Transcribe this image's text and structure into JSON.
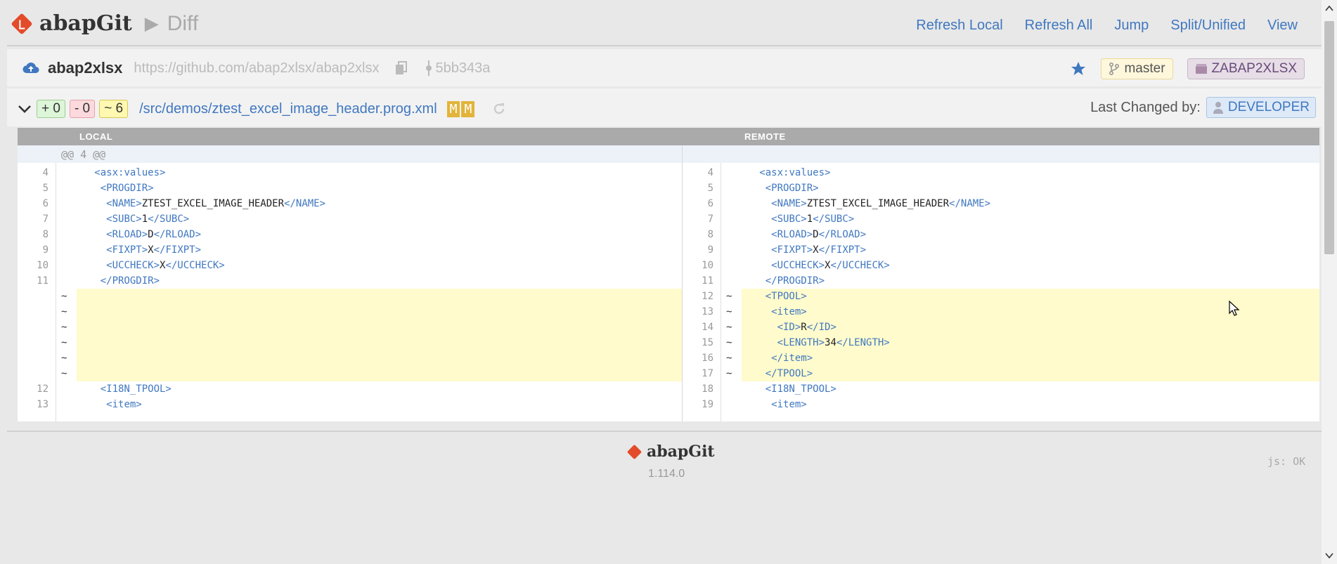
{
  "header": {
    "brand": "abapGit",
    "separator": "▶",
    "page": "Diff",
    "nav": [
      "Refresh Local",
      "Refresh All",
      "Jump",
      "Split/Unified",
      "View"
    ]
  },
  "repo": {
    "name": "abap2xlsx",
    "url": "https://github.com/abap2xlsx/abap2xlsx",
    "commit": "5bb343a",
    "branch": "master",
    "package": "ZABAP2XLSX"
  },
  "file": {
    "stat_add": "+ 0",
    "stat_del": "- 0",
    "stat_mod": "~ 6",
    "path": "/src/demos/ztest_excel_image_header.prog.xml",
    "local_state": "M",
    "remote_state": "M",
    "last_changed_label": "Last Changed by:",
    "last_changed_user": "DEVELOPER"
  },
  "diff": {
    "local_label": "LOCAL",
    "remote_label": "REMOTE",
    "hunk": "@@ 4 @@",
    "rows": [
      {
        "ln": "4",
        "lt": "   <asx:values>",
        "rn": "4",
        "rt": "   <asx:values>",
        "changed": false
      },
      {
        "ln": "5",
        "lt": "    <PROGDIR>",
        "rn": "5",
        "rt": "    <PROGDIR>",
        "changed": false
      },
      {
        "ln": "6",
        "lt": "     <NAME>ZTEST_EXCEL_IMAGE_HEADER</NAME>",
        "rn": "6",
        "rt": "     <NAME>ZTEST_EXCEL_IMAGE_HEADER</NAME>",
        "changed": false
      },
      {
        "ln": "7",
        "lt": "     <SUBC>1</SUBC>",
        "rn": "7",
        "rt": "     <SUBC>1</SUBC>",
        "changed": false
      },
      {
        "ln": "8",
        "lt": "     <RLOAD>D</RLOAD>",
        "rn": "8",
        "rt": "     <RLOAD>D</RLOAD>",
        "changed": false
      },
      {
        "ln": "9",
        "lt": "     <FIXPT>X</FIXPT>",
        "rn": "9",
        "rt": "     <FIXPT>X</FIXPT>",
        "changed": false
      },
      {
        "ln": "10",
        "lt": "     <UCCHECK>X</UCCHECK>",
        "rn": "10",
        "rt": "     <UCCHECK>X</UCCHECK>",
        "changed": false
      },
      {
        "ln": "11",
        "lt": "    </PROGDIR>",
        "rn": "11",
        "rt": "    </PROGDIR>",
        "changed": false
      },
      {
        "ln": "",
        "lt": "",
        "rn": "12",
        "rt": "    <TPOOL>",
        "changed": true
      },
      {
        "ln": "",
        "lt": "",
        "rn": "13",
        "rt": "     <item>",
        "changed": true
      },
      {
        "ln": "",
        "lt": "",
        "rn": "14",
        "rt": "      <ID>R</ID>",
        "changed": true
      },
      {
        "ln": "",
        "lt": "",
        "rn": "15",
        "rt": "      <LENGTH>34</LENGTH>",
        "changed": true
      },
      {
        "ln": "",
        "lt": "",
        "rn": "16",
        "rt": "     </item>",
        "changed": true
      },
      {
        "ln": "",
        "lt": "",
        "rn": "17",
        "rt": "    </TPOOL>",
        "changed": true
      },
      {
        "ln": "12",
        "lt": "    <I18N_TPOOL>",
        "rn": "18",
        "rt": "    <I18N_TPOOL>",
        "changed": false
      },
      {
        "ln": "13",
        "lt": "     <item>",
        "rn": "19",
        "rt": "     <item>",
        "changed": false
      }
    ],
    "change_mark": "~"
  },
  "footer": {
    "brand": "abapGit",
    "version": "1.114.0",
    "js_status": "js: OK"
  },
  "colors": {
    "accent": "#4078c0",
    "logo": "#e34b2a",
    "changed_bg": "#fffbcc",
    "header_bg": "#aaaaaa"
  }
}
